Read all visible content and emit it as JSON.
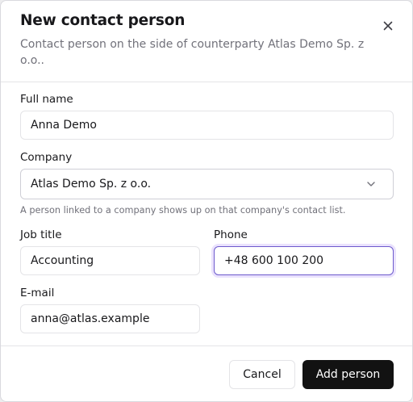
{
  "dialog": {
    "title": "New contact person",
    "subtitle": "Contact person on the side of counterparty Atlas Demo Sp. z o.o..",
    "close_icon": "close-icon"
  },
  "form": {
    "full_name": {
      "label": "Full name",
      "value": "Anna Demo"
    },
    "company": {
      "label": "Company",
      "value": "Atlas Demo Sp. z o.o.",
      "helper": "A person linked to a company shows up on that company's contact list.",
      "icon": "chevron-down-icon"
    },
    "job_title": {
      "label": "Job title",
      "value": "Accounting"
    },
    "phone": {
      "label": "Phone",
      "value": "+48 600 100 200"
    },
    "email": {
      "label": "E-mail",
      "value": "anna@atlas.example"
    }
  },
  "footer": {
    "cancel_label": "Cancel",
    "submit_label": "Add person"
  },
  "colors": {
    "primary_button": "#121212",
    "focus_ring": "#6d5acd",
    "muted_text": "#71717a",
    "border": "#e4e4e7"
  }
}
